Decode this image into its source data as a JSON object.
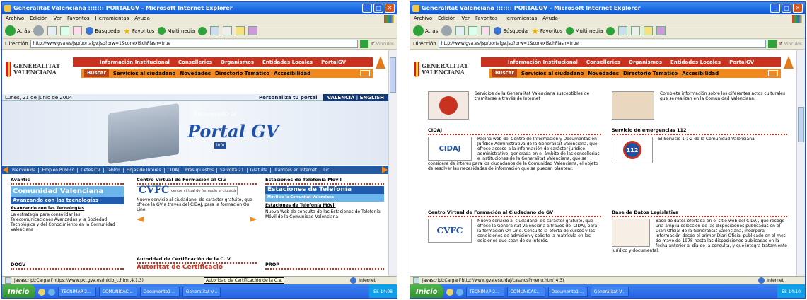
{
  "browser": {
    "title": "Generalitat Valenciana ::::::: PORTALGV - Microsoft Internet Explorer",
    "menu": [
      "Archivo",
      "Edición",
      "Ver",
      "Favoritos",
      "Herramientas",
      "Ayuda"
    ],
    "toolbar": {
      "back": "Atrás",
      "search": "Búsqueda",
      "favorites": "Favoritos",
      "multimedia": "Multimedia"
    },
    "address_label": "Dirección",
    "go_label": "Ir",
    "links_label": "Vínculos"
  },
  "site": {
    "logo": "GENERALITAT VALENCIANA",
    "nav_top": [
      "Información Institucional",
      "Conselleries",
      "Organismos",
      "Entidades Locales",
      "PortalGV"
    ],
    "nav_bottom": [
      "Buscar",
      "Servicios al ciudadano",
      "Novedades",
      "Directorio Temático",
      "Accesibilidad"
    ]
  },
  "left": {
    "url": "http://www.gva.es/jsp/portalgv.jsp?brw=1&conexi&chFlash=true",
    "date": "Lunes, 21 de junio de 2004",
    "personalize": "Personaliza tu portal",
    "lang": "VALENCIÀ | ENGLISH",
    "hero_welcome": "Bienvenido al",
    "hero_title": "Portal GV",
    "hero_info": "info",
    "links": [
      "Bienvenida",
      "Empleo Público",
      "Cetes CV",
      "Tablón",
      "Hojas de Interés",
      "CIDAJ",
      "Presupuestos",
      "Selvolta 21",
      "Gratuita",
      "Trámites en Internet",
      "Lic"
    ],
    "col1": {
      "head": "Avantic",
      "banner1": "Comunidad Valenciana",
      "banner2": "Avanzando con las tecnologías",
      "link": "Avanzando con las Tecnologías",
      "text": "La estrategia para consolidar las Telecomunicaciones Avanzadas y la Sociedad Tecnológica y del Conocimiento en la Comunidad Valenciana"
    },
    "col2": {
      "head": "Centro Virtual de Formación al Cíu",
      "logo": "CVFC",
      "logo_sub": "centre virtual de formació al ciutadà",
      "text": "Nuevo servicio al ciudadano, de carácter gratuito, que ofrece la GV a través del CIDAJ, para la formación On Line"
    },
    "col3": {
      "head": "Estaciones de Telefonía Móvil",
      "banner1": "Estaciones de Telefonía",
      "banner2": "Móvil de la Comunitat Valenciana",
      "link": "Estaciones de Telefonía Móvil",
      "text": "Nueva Web de consulta de las Estaciones de Telefonía Móvil de la Comunidad Valenciana"
    },
    "row2": [
      "DOGV",
      "Autoridad de Certificación de la C. V.",
      "PROP"
    ],
    "certif": "Autoritat de Certificació",
    "status": "javascript:Cargar('https://www.pki.gva.es/inicio_c.htm',4,1,3)",
    "tooltip": "Autoridad de Certificación de la C.V."
  },
  "right": {
    "url": "http://www.gva.es/jsp/portalgv.jsp?brw=1&conexi&chFlash=true",
    "sec1": {
      "text": "Servicios de la Generalitat Valenciana susceptibles de tramitarse a través de Internet"
    },
    "sec2": {
      "text": "Completa información sobre los diferentes actos culturales que se realizan en la Comunidad Valenciana."
    },
    "sec3": {
      "head": "CIDAJ",
      "logo": "CIDAJ",
      "text": "Página web del Centro de Información y Documentación Jurídico Administrativa de la Generalitat Valenciana, que ofrece acceso a la información de carácter jurídico-administrativo, generada en el ámbito de las consellerias e instituciones de la Generalitat Valenciana, que se considere de interés para los ciudadanos de la Comunidad Valenciana, el objeto de resolver las necesidades de información que se puedan plantear."
    },
    "sec4": {
      "head": "Servicio de emergencias 112",
      "logo": "112",
      "text": "El Servicio 1·1·2 de la Comunidad Valenciana"
    },
    "sec5": {
      "head": "Centro Virtual de Formación al Ciudadano de GV",
      "logo": "CVFC",
      "text": "Nuevo servicio al ciudadano, de carácter gratuito, que ofrece la Generalitat Valenciana a través del CIDAJ, para la formación On Line. Consulte la oferta de cursos y las condiciones de admisión y solicite la matrícula en las ediciones que sean de su interés."
    },
    "sec6": {
      "head": "Base de Datos Legislativa",
      "text": "Base de datos ofertada en el sitio web del CIDAJ, que recoge una amplia colección de las disposiciones publicadas en el Diari Oficial de la Generalitat Valenciana, incorpora información desde el primer Diari Oficial publicado en el mes de mayo de 1978 hasta las disposiciones publicadas en la fecha anterior al día de la consulta, y que integra tratamiento jurídico y documental."
    },
    "status": "javascript:Cargar('http://www.gva.es/cidaj/cas/ncsl/menu.htm',4,3)"
  },
  "statusbar": {
    "zone": "Internet"
  },
  "taskbar": {
    "start": "Inicio",
    "left_items": [
      "TECNIMAP 2...",
      "COMUNICAC...",
      "Documento1 ...",
      "Generalitat V..."
    ],
    "left_clock": "14:08",
    "right_items": [
      "TECNIMAP 2...",
      "COMUNICAC...",
      "Documento1 ...",
      "Generalitat V..."
    ],
    "right_clock": "14:10",
    "lang": "ES"
  }
}
